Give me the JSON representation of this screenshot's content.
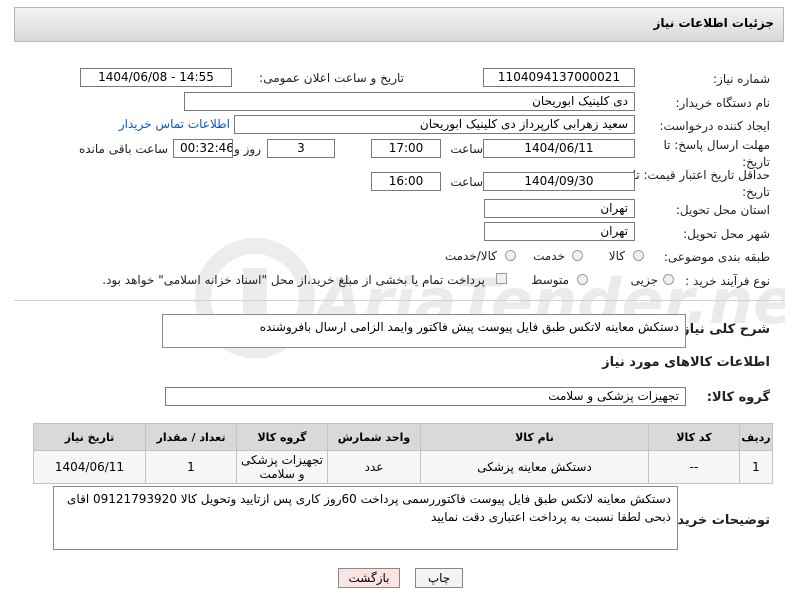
{
  "header": {
    "title": "جزئیات اطلاعات نیاز"
  },
  "fields": {
    "need_number_label": "شماره نیاز:",
    "need_number": "1104094137000021",
    "announce_label": "تاریخ و ساعت اعلان عمومی:",
    "announce_value": "1404/06/08 - 14:55",
    "buyer_org_label": "نام دستگاه خریدار:",
    "buyer_org": "دی کلینیک ابوریحان",
    "creator_label": "ایجاد کننده درخواست:",
    "creator": "سعید زهرابی کارپرداز دی کلینیک ابوریحان",
    "contact_link": "اطلاعات تماس خریدار",
    "reply_deadline_label": "مهلت ارسال پاسخ: تا تاریخ:",
    "reply_date": "1404/06/11",
    "time_label": "ساعت",
    "reply_time": "17:00",
    "days_value": "3",
    "days_label": "روز و",
    "remaining_time": "00:32:46",
    "remaining_label": "ساعت باقی مانده",
    "price_validity_label": "حداقل تاریخ اعتبار قیمت: تا تاریخ:",
    "price_date": "1404/09/30",
    "price_time": "16:00",
    "province_label": "استان محل تحویل:",
    "province": "تهران",
    "city_label": "شهر محل تحویل:",
    "city": "تهران",
    "category_label": "طبقه بندی موضوعی:",
    "category_options": [
      "کالا",
      "خدمت",
      "کالا/خدمت"
    ],
    "process_label": "نوع فرآیند خرید :",
    "process_options": [
      "جزیی",
      "متوسط"
    ],
    "payment_note": "پرداخت تمام یا بخشی از مبلغ خرید،از محل \"اسناد خزانه اسلامی\" خواهد بود.",
    "description_label": "شرح کلی نیاز:",
    "description": "دستکش معاینه لاتکس طبق فایل پیوست پیش فاکتور وایمد الزامی ارسال بافروشنده"
  },
  "goods": {
    "section_title": "اطلاعات کالاهای مورد نیاز",
    "group_label": "گروه کالا:",
    "group_value": "تجهیزات پزشکی و سلامت",
    "columns": [
      "ردیف",
      "کد کالا",
      "نام کالا",
      "واحد شمارش",
      "گروه کالا",
      "تعداد / مقدار",
      "تاریخ نیاز"
    ],
    "rows": [
      [
        "1",
        "--",
        "دستکش معاینه پزشکی",
        "عدد",
        "تجهیزات پزشکی و سلامت",
        "1",
        "1404/06/11"
      ]
    ]
  },
  "buyer_notes": {
    "label": "توضیحات خریدار:",
    "text": "دستکش معاینه لاتکس طبق فایل پیوست فاکتوررسمی پرداخت 60روز کاری پس ازتایید وتحویل کالا 09121793920 اقای ذبحی لطفا نسبت به پرداخت اعتباری دقت نمایید"
  },
  "buttons": {
    "print": "چاپ",
    "back": "بازگشت"
  },
  "watermark": "AriaTender.net",
  "colors": {
    "link": "#1155cc",
    "back_button_bg": "#fbe3e3",
    "print_button_bg": "#f3f3f3"
  }
}
